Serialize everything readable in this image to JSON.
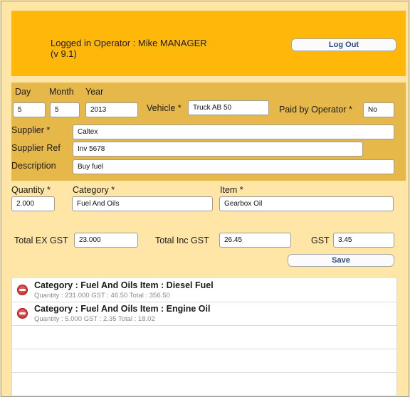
{
  "header": {
    "operator_text": "Logged in Operator : Mike MANAGER",
    "version_text": "(v 9.1)",
    "logout_label": "Log Out",
    "background_color": "#ffb80a"
  },
  "form": {
    "day_label": "Day",
    "month_label": "Month",
    "year_label": "Year",
    "day_value": "5",
    "month_value": "5",
    "year_value": "2013",
    "vehicle_label": "Vehicle *",
    "vehicle_value": "Truck AB 50",
    "paid_label": "Paid by Operator *",
    "paid_value": "No",
    "supplier_label": "Supplier *",
    "supplier_value": "Caltex",
    "supplier_ref_label": "Supplier Ref",
    "supplier_ref_value": "Inv 5678",
    "description_label": "Description",
    "description_value": "Buy fuel",
    "quantity_label": "Quantity *",
    "quantity_value": "2.000",
    "category_label": "Category *",
    "category_value": "Fuel And Oils",
    "item_label": "Item *",
    "item_value": "Gearbox Oil",
    "total_ex_label": "Total EX GST",
    "total_ex_value": "23.000",
    "total_inc_label": "Total Inc GST",
    "total_inc_value": "26.45",
    "gst_label": "GST",
    "gst_value": "3.45",
    "save_label": "Save"
  },
  "items": [
    {
      "title": "Category : Fuel And Oils Item : Diesel Fuel",
      "details": "Quantity : 231.000   GST : 46.50   Total : 356.50"
    },
    {
      "title": "Category : Fuel And Oils Item : Engine Oil",
      "details": "Quantity : 5.000   GST : 2.35   Total : 18.02"
    }
  ],
  "icons": {
    "delete": "delete-minus-icon"
  }
}
